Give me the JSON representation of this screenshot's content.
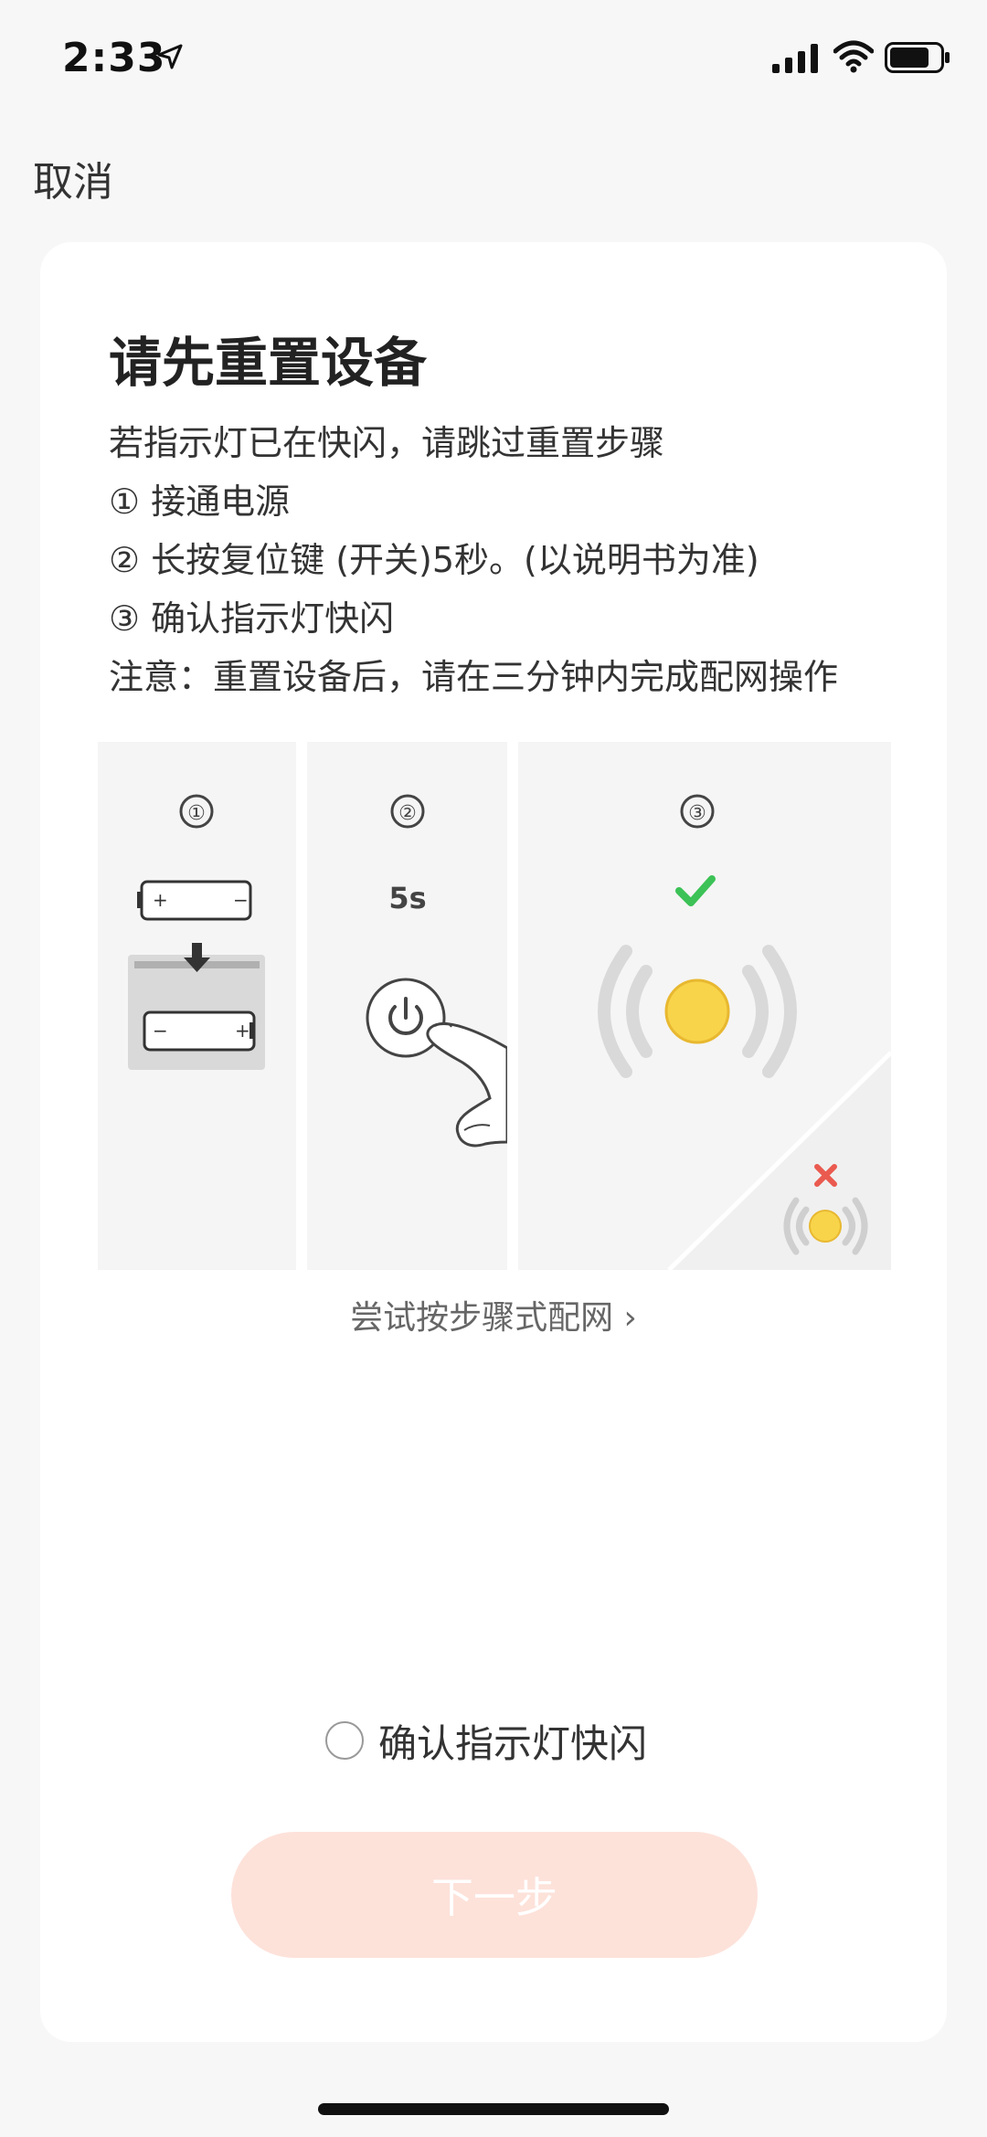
{
  "status_bar": {
    "time": "2:33"
  },
  "nav": {
    "cancel_label": "取消"
  },
  "card": {
    "title": "请先重置设备",
    "lines": [
      "若指示灯已在快闪，请跳过重置步骤",
      "① 接通电源",
      "② 长按复位键 (开关)5秒。(以说明书为准)",
      "③ 确认指示灯快闪",
      "注意：重置设备后，请在三分钟内完成配网操作"
    ],
    "illustration": {
      "step1_number": "①",
      "step2_number": "②",
      "step2_duration": "5s",
      "step3_number": "③",
      "colors": {
        "success": "#3cc256",
        "error": "#ea5a4f",
        "light": "#f8d44a",
        "wave": "#d9d9d9"
      }
    },
    "try_link": "尝试按步骤式配网 ›",
    "confirm_label": "确认指示灯快闪",
    "next_label": "下一步"
  },
  "colors": {
    "next_button_bg": "#fde2da",
    "background": "#f7f7f7"
  }
}
